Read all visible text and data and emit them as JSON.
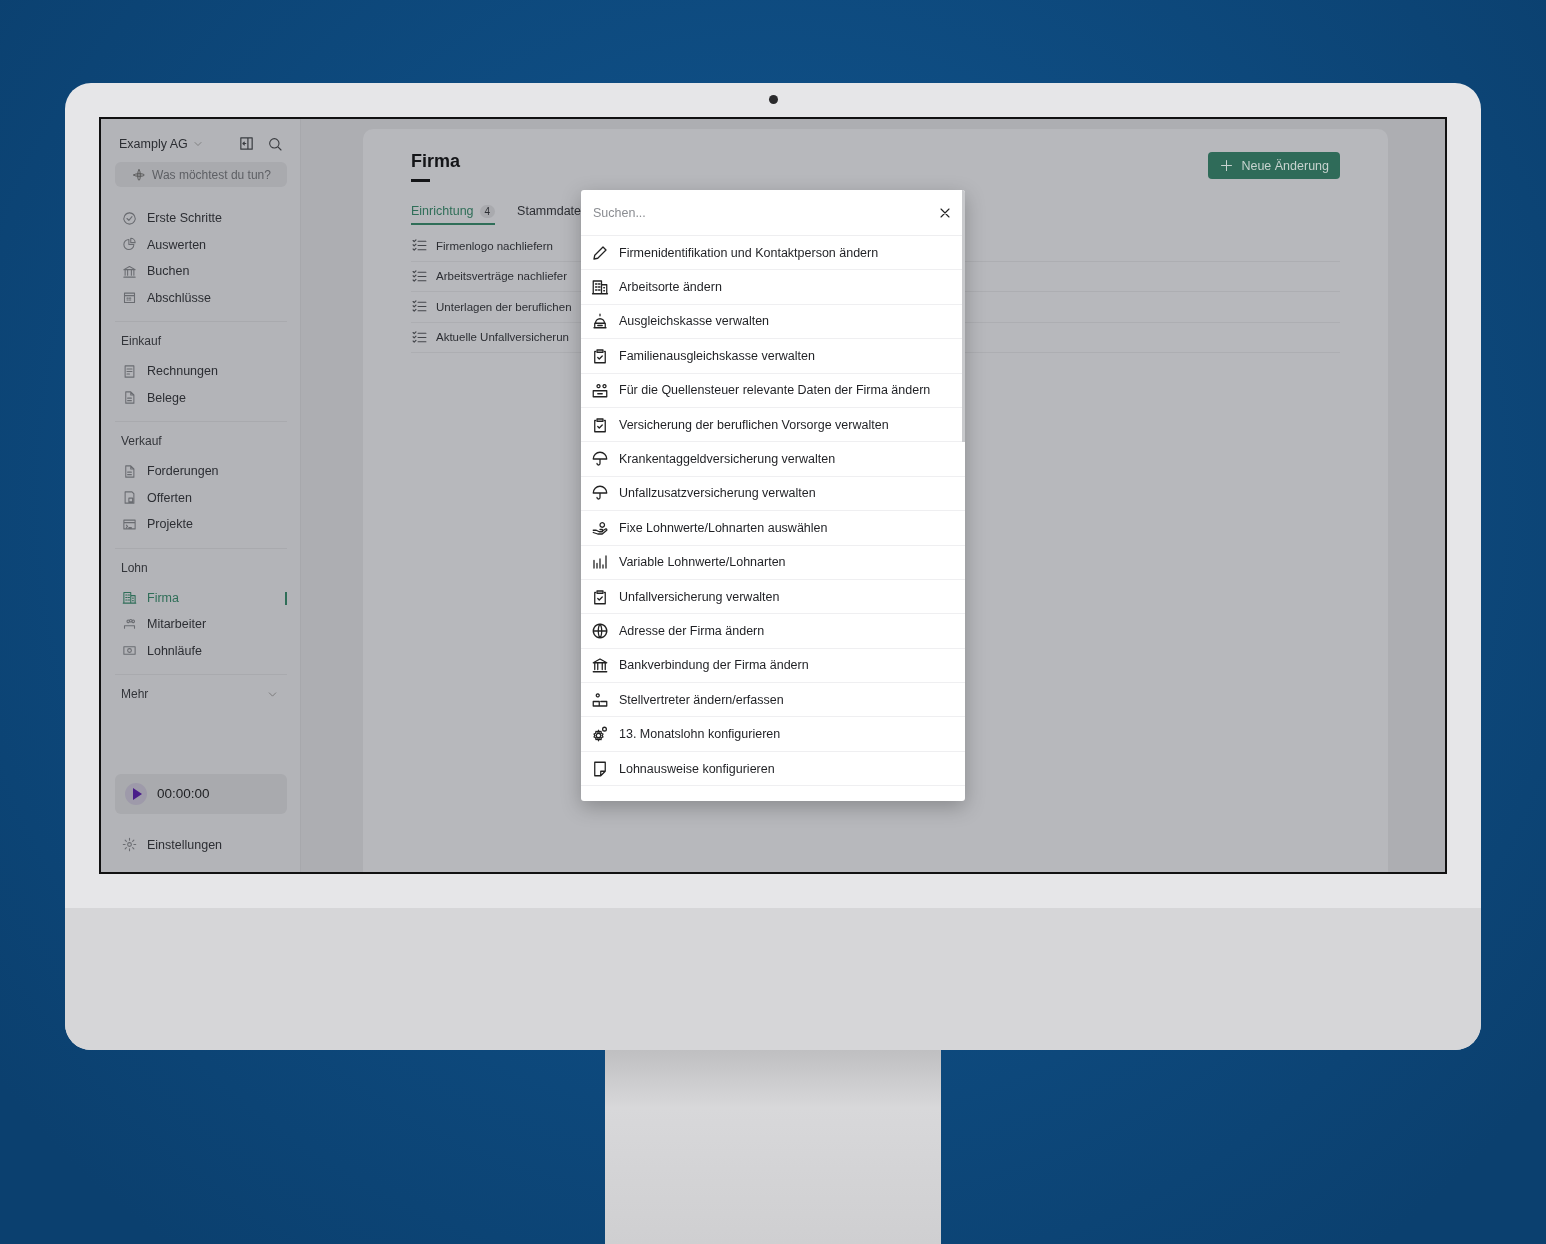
{
  "sidebar": {
    "company": "Examply AG",
    "ask_placeholder": "Was möchtest du tun?",
    "sections": [
      {
        "items": [
          {
            "label": "Erste Schritte",
            "selected": false
          },
          {
            "label": "Auswerten",
            "selected": false
          },
          {
            "label": "Buchen",
            "selected": false
          },
          {
            "label": "Abschlüsse",
            "selected": false
          }
        ]
      },
      {
        "title": "Einkauf",
        "items": [
          {
            "label": "Rechnungen",
            "selected": false
          },
          {
            "label": "Belege",
            "selected": false
          }
        ]
      },
      {
        "title": "Verkauf",
        "items": [
          {
            "label": "Forderungen",
            "selected": false
          },
          {
            "label": "Offerten",
            "selected": false
          },
          {
            "label": "Projekte",
            "selected": false
          }
        ]
      },
      {
        "title": "Lohn",
        "items": [
          {
            "label": "Firma",
            "selected": true
          },
          {
            "label": "Mitarbeiter",
            "selected": false
          },
          {
            "label": "Lohnläufe",
            "selected": false
          }
        ]
      }
    ],
    "more": {
      "label": "Mehr",
      "expanded": false
    },
    "timer": "00:00:00",
    "settings": "Einstellungen"
  },
  "page": {
    "title": "Firma",
    "new_button": "Neue Änderung",
    "tabs": [
      {
        "label": "Einrichtung",
        "count": "4",
        "selected": true
      },
      {
        "label": "Stammdate",
        "selected": false
      }
    ],
    "tasks": [
      "Firmenlogo nachliefern",
      "Arbeitsverträge nachliefer",
      "Unterlagen der beruflichen",
      "Aktuelle Unfallversicherun"
    ]
  },
  "dialog": {
    "search_placeholder": "Suchen...",
    "items": [
      "Firmenidentifikation und Kontaktperson ändern",
      "Arbeitsorte ändern",
      "Ausgleichskasse verwalten",
      "Familienausgleichskasse verwalten",
      "Für die Quellensteuer relevante Daten der Firma ändern",
      "Versicherung der beruflichen Vorsorge verwalten",
      "Krankentaggeldversicherung verwalten",
      "Unfallzusatzversicherung verwalten",
      "Fixe Lohnwerte/Lohnarten auswählen",
      "Variable Lohnwerte/Lohnarten",
      "Unfallversicherung verwalten",
      "Adresse der Firma ändern",
      "Bankverbindung der Firma ändern",
      "Stellvertreter ändern/erfassen",
      "13. Monatslohn konfigurieren",
      "Lohnausweise konfigurieren"
    ]
  }
}
